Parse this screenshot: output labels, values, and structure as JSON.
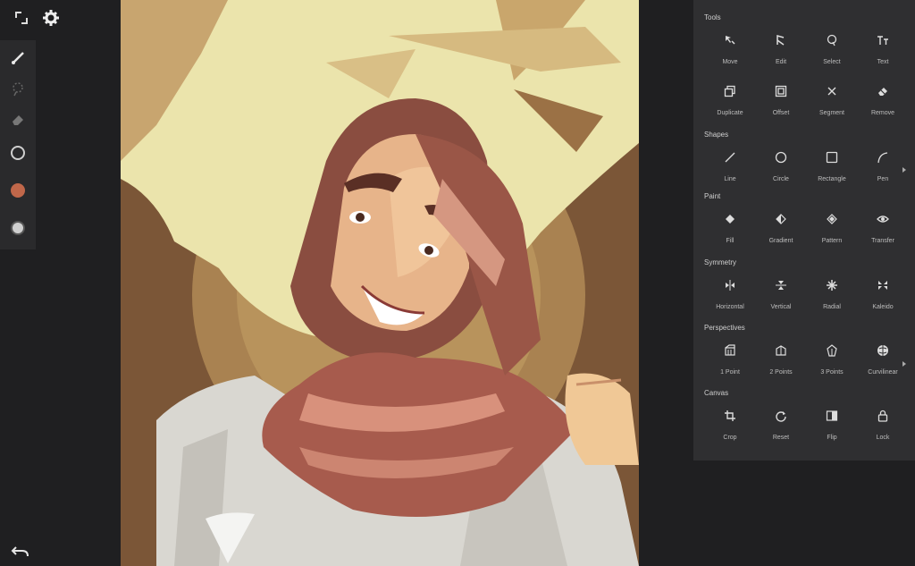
{
  "topbar": {
    "icons": [
      "collapse-icon",
      "gear-icon"
    ]
  },
  "left_toolbar": {
    "tools": [
      "brush-icon",
      "lasso-icon",
      "eraser-icon",
      "circle-tool-icon",
      "color-swatch",
      "opacity-swatch"
    ],
    "current_color": "#c0674a"
  },
  "undo": {
    "icon": "undo-icon"
  },
  "tools_panel": {
    "sections": [
      {
        "title": "Tools",
        "items": [
          "Move",
          "Edit",
          "Select",
          "Text",
          "Duplicate",
          "Offset",
          "Segment",
          "Remove"
        ]
      },
      {
        "title": "Shapes",
        "items": [
          "Line",
          "Circle",
          "Rectangle",
          "Pen"
        ]
      },
      {
        "title": "Paint",
        "items": [
          "Fill",
          "Gradient",
          "Pattern",
          "Transfer"
        ]
      },
      {
        "title": "Symmetry",
        "items": [
          "Horizontal",
          "Vertical",
          "Radial",
          "Kaleido"
        ]
      },
      {
        "title": "Perspectives",
        "items": [
          "1 Point",
          "2 Points",
          "3 Points",
          "Curvilinear"
        ]
      },
      {
        "title": "Canvas",
        "items": [
          "Crop",
          "Reset",
          "Flip",
          "Lock"
        ]
      }
    ]
  },
  "colors": {
    "bg": "#1f1f21",
    "panel": "#2f2f31",
    "accent": "#c0674a"
  }
}
